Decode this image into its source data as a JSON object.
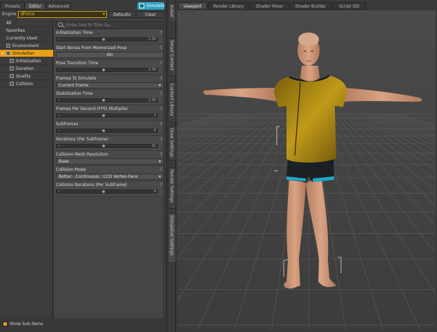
{
  "left": {
    "tabs": [
      "Presets",
      "Editor",
      "Advanced"
    ],
    "simulate_label": "Simulate",
    "engine_label": "Engine :",
    "engine_value": "dForce",
    "defaults_label": "Defaults",
    "clear_label": "Clear",
    "tree": [
      {
        "label": "All",
        "level": 0
      },
      {
        "label": "Favorites",
        "level": 0
      },
      {
        "label": "Currently Used",
        "level": 0
      },
      {
        "label": "Environment",
        "level": 0,
        "icon": true
      },
      {
        "label": "Simulation",
        "level": 0,
        "icon": true,
        "selected": true,
        "arrow": true
      },
      {
        "label": "Initialization",
        "level": 1,
        "icon": true
      },
      {
        "label": "Duration",
        "level": 1,
        "icon": true
      },
      {
        "label": "Quality",
        "level": 1,
        "icon": true
      },
      {
        "label": "Collision",
        "level": 1,
        "icon": true
      }
    ],
    "filter_placeholder": "Enter text to filter by...",
    "props": [
      {
        "label": "Initialization Time",
        "type": "slider",
        "min": "0",
        "value": "1.00",
        "pos": 0.45
      },
      {
        "label": "Start Bones From Memorized Pose",
        "type": "toggle",
        "value": "On"
      },
      {
        "label": "Pose Transition Time",
        "type": "slider",
        "min": "0",
        "value": "1.00",
        "pos": 0.45
      },
      {
        "label": "Frames To Simulate",
        "type": "dropdown",
        "value": "Current Frame"
      },
      {
        "label": "Stabilization Time",
        "type": "slider",
        "min": "0",
        "value": "1.00",
        "pos": 0.45
      },
      {
        "label": "Frames Per Second (FPS) Multiplier",
        "type": "slider",
        "min": "1",
        "value": "2",
        "pos": 0.45
      },
      {
        "label": "Subframes",
        "type": "slider",
        "min": "1",
        "value": "6",
        "pos": 0.45
      },
      {
        "label": "Iterations (Per Subframe)",
        "type": "slider",
        "min": "1",
        "value": "32",
        "pos": 0.45
      },
      {
        "label": "Collision Mesh Resolution",
        "type": "dropdown",
        "value": "Base"
      },
      {
        "label": "Collision Mode",
        "type": "dropdown",
        "value": "Better - Continuous : CCD Vertex-Face"
      },
      {
        "label": "Collision Iterations (Per Subframe)",
        "type": "slider",
        "min": "1",
        "value": "4",
        "pos": 0.45
      }
    ],
    "show_sub_items": "Show Sub Items"
  },
  "side_tabs": [
    "Install",
    "Smart Content",
    "Content Library",
    "Draw Settings",
    "Render Settings",
    "Simulation Settings"
  ],
  "right": {
    "tabs": [
      "Viewport",
      "Render Library",
      "Shader Mixer",
      "Shader Builder",
      "Script IDE"
    ]
  },
  "colors": {
    "accent": "#e8a117",
    "simulate": "#2fa2c3",
    "shirt": "#b08a14",
    "skin": "#c99576"
  }
}
